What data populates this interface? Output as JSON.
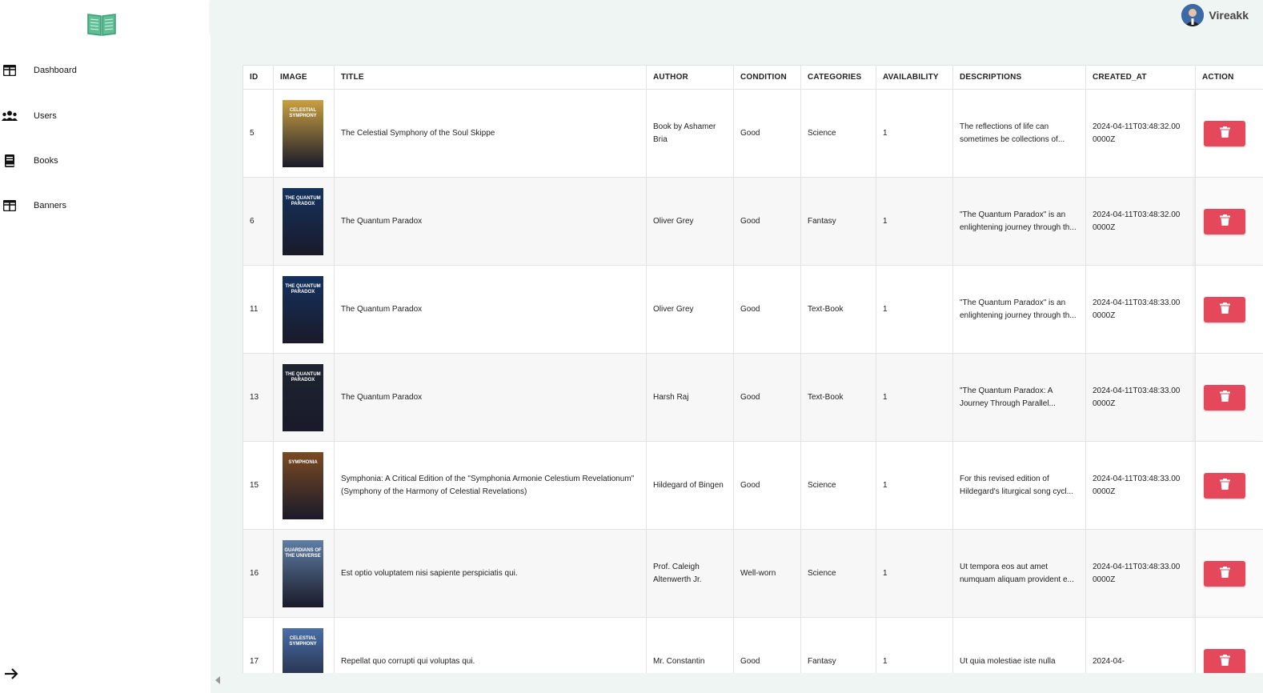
{
  "sidebar": {
    "items": [
      {
        "label": "Dashboard",
        "icon": "table-icon"
      },
      {
        "label": "Users",
        "icon": "users-icon"
      },
      {
        "label": "Books",
        "icon": "book-icon"
      },
      {
        "label": "Banners",
        "icon": "table-icon"
      }
    ]
  },
  "header": {
    "username": "Vireakk"
  },
  "table": {
    "columns": [
      "ID",
      "IMAGE",
      "TITLE",
      "AUTHOR",
      "CONDITION",
      "CATEGORIES",
      "AVAILABILITY",
      "DESCRIPTIONS",
      "CREATED_AT",
      "ACTION"
    ],
    "rows": [
      {
        "id": "5",
        "title": "The Celestial Symphony of the Soul Skippe",
        "author": "Book by Ashamer Bria",
        "condition": "Good",
        "category": "Science",
        "availability": "1",
        "description": "The reflections of life can sometimes be collections of...",
        "created_at": "2024-04-11T03:48:32.000000Z",
        "cover_text": "CELESTIAL SYMPHONY",
        "cover_color": "#c9a040"
      },
      {
        "id": "6",
        "title": "The Quantum Paradox",
        "author": "Oliver Grey",
        "condition": "Good",
        "category": "Fantasy",
        "availability": "1",
        "description": "\"The Quantum Paradox\" is an enlightening journey through th...",
        "created_at": "2024-04-11T03:48:32.000000Z",
        "cover_text": "THE QUANTUM PARADOX",
        "cover_color": "#14325e"
      },
      {
        "id": "11",
        "title": "The Quantum Paradox",
        "author": "Oliver Grey",
        "condition": "Good",
        "category": "Text-Book",
        "availability": "1",
        "description": "\"The Quantum Paradox\" is an enlightening journey through th...",
        "created_at": "2024-04-11T03:48:33.000000Z",
        "cover_text": "THE QUANTUM PARADOX",
        "cover_color": "#14325e"
      },
      {
        "id": "13",
        "title": "The Quantum Paradox",
        "author": "Harsh Raj",
        "condition": "Good",
        "category": "Text-Book",
        "availability": "1",
        "description": "\"The Quantum Paradox: A Journey Through Parallel...",
        "created_at": "2024-04-11T03:48:33.000000Z",
        "cover_text": "THE QUANTUM PARADOX",
        "cover_color": "#1d2430"
      },
      {
        "id": "15",
        "title": "Symphonia: A Critical Edition of the \"Symphonia Armonie Celestium Revelationum\" (Symphony of the Harmony of Celestial Revelations)",
        "author": "Hildegard of Bingen",
        "condition": "Good",
        "category": "Science",
        "availability": "1",
        "description": "For this revised edition of Hildegard's liturgical song cycl...",
        "created_at": "2024-04-11T03:48:33.000000Z",
        "cover_text": "SYMPHONIA",
        "cover_color": "#7a4a22"
      },
      {
        "id": "16",
        "title": "Est optio voluptatem nisi sapiente perspiciatis qui.",
        "author": "Prof. Caleigh Altenwerth Jr.",
        "condition": "Well-worn",
        "category": "Science",
        "availability": "1",
        "description": "Ut tempora eos aut amet numquam aliquam provident e...",
        "created_at": "2024-04-11T03:48:33.000000Z",
        "cover_text": "GUARDIANS OF THE UNIVERSE",
        "cover_color": "#5e7ea3"
      },
      {
        "id": "17",
        "title": "Repellat quo corrupti qui voluptas qui.",
        "author": "Mr. Constantin",
        "condition": "Good",
        "category": "Fantasy",
        "availability": "1",
        "description": "Ut quia molestiae iste nulla",
        "created_at": "2024-04-",
        "cover_text": "CELESTIAL SYMPHONY",
        "cover_color": "#4a6fa8"
      }
    ]
  },
  "colors": {
    "accent": "#e5485b",
    "background": "#eef5f2",
    "logo": "#3a9b74"
  }
}
